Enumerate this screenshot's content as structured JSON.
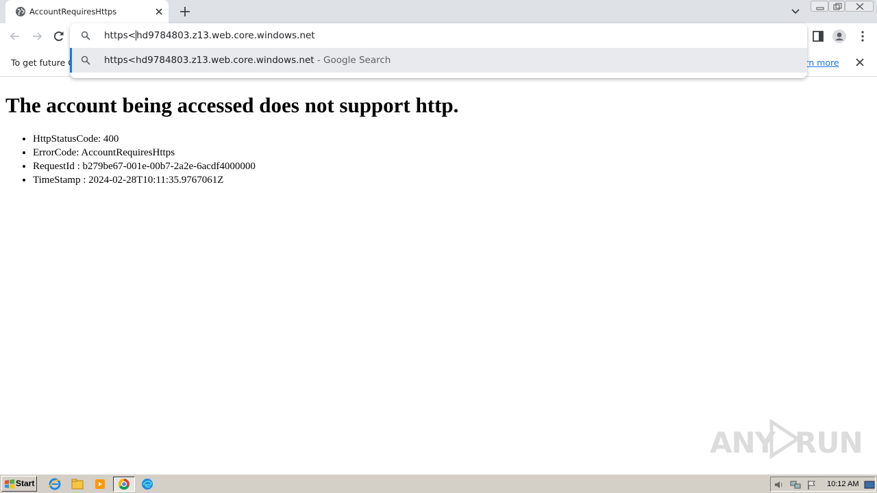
{
  "browser": {
    "tab": {
      "title": "AccountRequiresHttps"
    },
    "omnibox": {
      "typed_prefix": "https<",
      "typed_rest": "hd9784803.z13.web.core.windows.net",
      "suggestion_text": "https<hd9784803.z13.web.core.windows.net",
      "suggestion_suffix": " - Google Search"
    },
    "infobar": {
      "text": "To get future G",
      "link": "earn more"
    }
  },
  "page": {
    "heading": "The account being accessed does not support http.",
    "items": [
      "HttpStatusCode: 400",
      "ErrorCode: AccountRequiresHttps",
      "RequestId : b279be67-001e-00b7-2a2e-6acdf4000000",
      "TimeStamp : 2024-02-28T10:11:35.9767061Z"
    ]
  },
  "watermark": {
    "left": "ANY",
    "right": "RUN"
  },
  "taskbar": {
    "start_label": "Start",
    "clock": "10:12 AM"
  },
  "colors": {
    "accent": "#1a73e8",
    "tabstrip": "#dee1e6",
    "taskbar": "#d4d0c8"
  }
}
